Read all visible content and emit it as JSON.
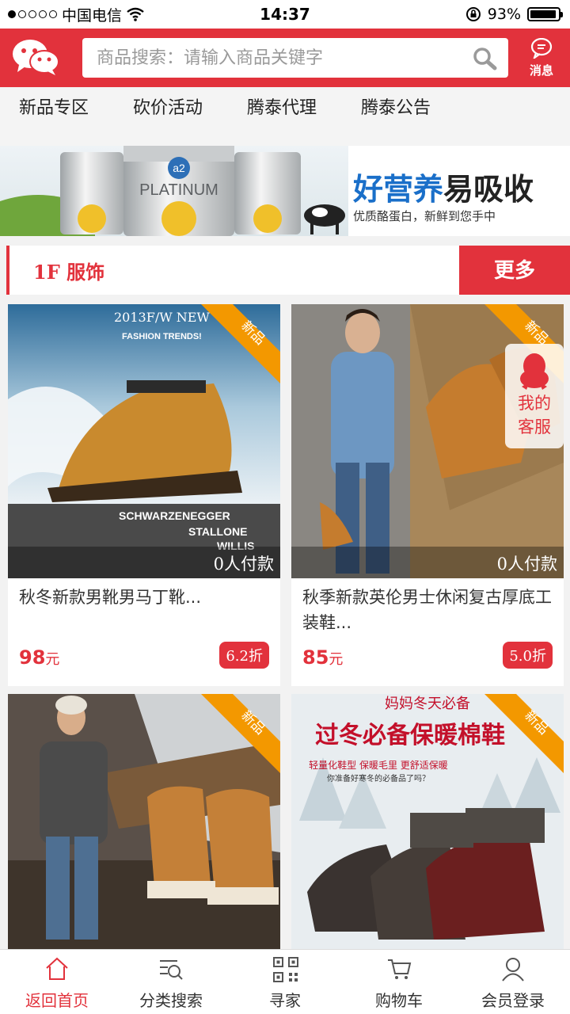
{
  "status_bar": {
    "carrier": "中国电信",
    "time": "14:37",
    "battery": "93%"
  },
  "header": {
    "search_placeholder": "商品搜索：请输入商品关键字",
    "message_label": "消息"
  },
  "category_nav": [
    "新品专区",
    "砍价活动",
    "腾泰代理",
    "腾泰公告"
  ],
  "banner": {
    "headline_a": "好营养",
    "headline_b": "易吸收",
    "subline": "优质酪蛋白，新鲜到您手中",
    "can_label": "PLATINUM",
    "can_brand": "a2"
  },
  "floor": {
    "title": "1F 服饰",
    "more_label": "更多"
  },
  "products": [
    {
      "title": "秋冬新款男靴男马丁靴...",
      "price": "98",
      "price_unit": "元",
      "discount": "6.2折",
      "paid": "0人付款",
      "badge": "新品",
      "image_caption": [
        "2013F/W NEW",
        "FASHION TRENDS!",
        "SCHWARZENEGGER",
        "STALLONE",
        "WILLIS"
      ]
    },
    {
      "title": "秋季新款英伦男士休闲复古厚底工装鞋...",
      "price": "85",
      "price_unit": "元",
      "discount": "5.0折",
      "paid": "0人付款",
      "badge": "新品"
    },
    {
      "title": "",
      "badge": "新品"
    },
    {
      "title": "",
      "badge": "新品",
      "image_caption": [
        "妈妈冬天必备",
        "过冬必备保暖棉鞋",
        "轻量化鞋型 保暖毛里 更舒适保暖",
        "你准备好寒冬的必备品了吗？"
      ]
    }
  ],
  "float_service": {
    "label_line1": "我的",
    "label_line2": "客服"
  },
  "tabbar": [
    "返回首页",
    "分类搜索",
    "寻家",
    "购物车",
    "会员登录"
  ],
  "colors": {
    "brand_red": "#e2323c",
    "ribbon_orange": "#f39800"
  }
}
